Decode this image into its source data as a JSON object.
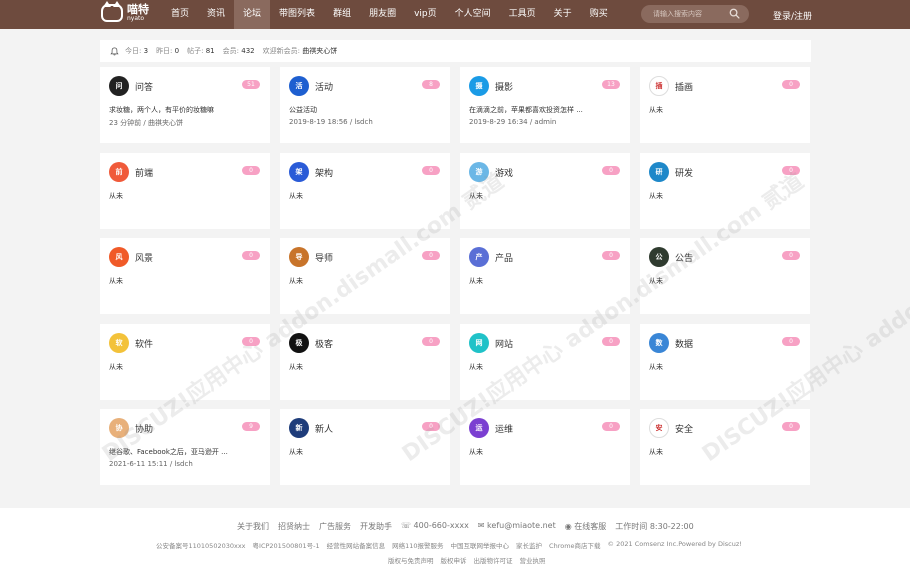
{
  "brand": {
    "name": "喵特",
    "sub": "nyato"
  },
  "nav": [
    "首页",
    "资讯",
    "论坛",
    "带图列表",
    "群组",
    "朋友圈",
    "vip页",
    "个人空间",
    "工具页",
    "关于",
    "购买"
  ],
  "nav_active": "论坛",
  "search": {
    "placeholder": "请输入搜索内容"
  },
  "login": "登录/注册",
  "stats": {
    "today_label": "今日:",
    "today": "3",
    "yesterday_label": "昨日:",
    "yesterday": "0",
    "posts_label": "帖子:",
    "posts": "81",
    "members_label": "会员:",
    "members": "432",
    "welcome_label": "欢迎新会员:",
    "welcome": "曲祺夹心饼"
  },
  "forums": [
    {
      "name": "问答",
      "count": "51",
      "line1": "求妆糖，两个人，有平价的妆糖嘛",
      "line2": "23 分钟前 / 曲祺夹心饼",
      "icon": "bio-icon",
      "color": "#222"
    },
    {
      "name": "活动",
      "count": "8",
      "line1": "公益活动",
      "line2": "2019-8-19 18:56 / lsdch",
      "icon": "activity-icon",
      "color": "#1e5fd0"
    },
    {
      "name": "摄影",
      "count": "13",
      "line1": "在滴滴之前，苹果都喜欢投资怎样 ...",
      "line2": "2019-8-29 16:34 / admin",
      "icon": "camera-icon",
      "color": "#1a9be6"
    },
    {
      "name": "插画",
      "count": "0",
      "line1": "从未",
      "line2": "",
      "icon": "csdn-icon",
      "color": "#ffffff"
    },
    {
      "name": "前端",
      "count": "0",
      "line1": "从未",
      "line2": "",
      "icon": "flower-icon",
      "color": "#f05a3a"
    },
    {
      "name": "架构",
      "count": "0",
      "line1": "从未",
      "line2": "",
      "icon": "architecture-icon",
      "color": "#2a5bd7"
    },
    {
      "name": "游戏",
      "count": "0",
      "line1": "从未",
      "line2": "",
      "icon": "game-icon",
      "color": "#6bb7e6"
    },
    {
      "name": "研发",
      "count": "0",
      "line1": "从未",
      "line2": "",
      "icon": "rd-icon",
      "color": "#1e88c9"
    },
    {
      "name": "风景",
      "count": "0",
      "line1": "从未",
      "line2": "",
      "icon": "landscape-icon",
      "color": "#f05a28"
    },
    {
      "name": "导师",
      "count": "0",
      "line1": "从未",
      "line2": "",
      "icon": "squirrel-icon",
      "color": "#c8742a"
    },
    {
      "name": "产品",
      "count": "0",
      "line1": "从未",
      "line2": "",
      "icon": "product-icon",
      "color": "#5a6fd6"
    },
    {
      "name": "公告",
      "count": "0",
      "line1": "从未",
      "line2": "",
      "icon": "notice-icon",
      "color": "#2f3b2f"
    },
    {
      "name": "软件",
      "count": "0",
      "line1": "从未",
      "line2": "",
      "icon": "software-icon",
      "color": "#f3c23a"
    },
    {
      "name": "极客",
      "count": "0",
      "line1": "从未",
      "line2": "",
      "icon": "penguin-icon",
      "color": "#111"
    },
    {
      "name": "网站",
      "count": "0",
      "line1": "从未",
      "line2": "",
      "icon": "website-icon",
      "color": "#20c2c8"
    },
    {
      "name": "数据",
      "count": "0",
      "line1": "从未",
      "line2": "",
      "icon": "cloud-icon",
      "color": "#3a86d6"
    },
    {
      "name": "协助",
      "count": "9",
      "line1": "继谷歌、Facebook之后，亚马逊开 ...",
      "line2": "2021-6-11 15:11 / lsdch",
      "icon": "help-icon",
      "color": "#e8b07a"
    },
    {
      "name": "新人",
      "count": "0",
      "line1": "从未",
      "line2": "",
      "icon": "newcomer-icon",
      "color": "#1e3c7a"
    },
    {
      "name": "运维",
      "count": "0",
      "line1": "从未",
      "line2": "",
      "icon": "ops-icon",
      "color": "#7b3fd1"
    },
    {
      "name": "安全",
      "count": "0",
      "line1": "从未",
      "line2": "",
      "icon": "security-icon",
      "color": "#ffffff"
    }
  ],
  "footer": {
    "links": [
      "关于我们",
      "招贤纳士",
      "广告服务",
      "开发助手",
      "☏ 400-660-xxxx",
      "✉ kefu@miaote.net",
      "◉ 在线客服",
      "工作时间 8:30-22:00"
    ],
    "row2": [
      "公安备案号11010502030xxx",
      "粤ICP201500801号-1",
      "经营性网站备案信息",
      "网络110报警服务",
      "中国互联网举报中心",
      "家长监护",
      "Chrome商店下载",
      "© 2021 Comsenz Inc.Powered by Discuz!"
    ],
    "row3": [
      "版权与免责声明",
      "版权申诉",
      "出版物许可证",
      "营业执照"
    ]
  },
  "watermark": "DISCUZ!应用中心 addon.dismall.com 贰道"
}
